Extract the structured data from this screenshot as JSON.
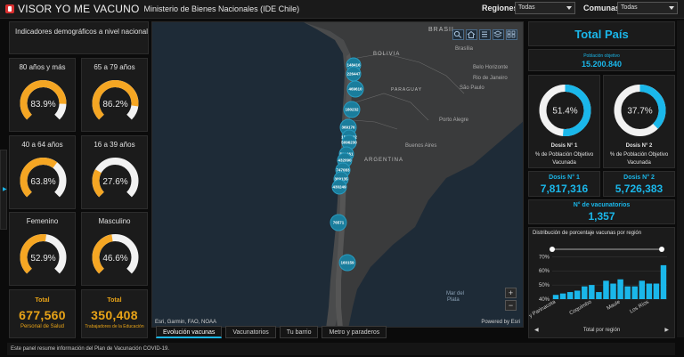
{
  "header": {
    "title": "VISOR YO ME VACUNO",
    "subtitle": "Ministerio de Bienes Nacionales (IDE Chile)",
    "regiones_label": "Regiones",
    "regiones_value": "Todas",
    "comunas_label": "Comunas",
    "comunas_value": "Todas"
  },
  "left": {
    "indicators_title": "Indicadores demográficos a nivel nacional",
    "gauges": [
      {
        "label": "80 años y más",
        "value_text": "83.9%",
        "value": 0.839,
        "color": "#f5a623"
      },
      {
        "label": "65 a 79 años",
        "value_text": "86.2%",
        "value": 0.862,
        "color": "#f5a623"
      },
      {
        "label": "40 a 64 años",
        "value_text": "63.8%",
        "value": 0.638,
        "color": "#f5a623"
      },
      {
        "label": "16 a 39 años",
        "value_text": "27.6%",
        "value": 0.276,
        "color": "#f5a623"
      },
      {
        "label": "Femenino",
        "value_text": "52.9%",
        "value": 0.529,
        "color": "#f5a623"
      },
      {
        "label": "Masculino",
        "value_text": "46.6%",
        "value": 0.466,
        "color": "#f5a623"
      }
    ],
    "totals": [
      {
        "title": "Total",
        "value": "677,560",
        "foot": "Personal de Salud"
      },
      {
        "title": "Total",
        "value": "350,408",
        "foot": "Trabajadores de la Educación"
      }
    ]
  },
  "map": {
    "country_labels": {
      "brasil": "BRASIL",
      "bolivia": "BOLIVIA",
      "paraguay": "PARAGUAY",
      "argentina": "ARGENTINA",
      "brasilia": "Brasília",
      "belo": "Belo Horizonte",
      "rio": "Rio de Janeiro",
      "sao": "São Paulo",
      "porto": "Porto Alegre",
      "buenos": "Buenos Aires",
      "mar": "Mar del",
      "plata": "Plata"
    },
    "clusters": [
      {
        "label": "148416"
      },
      {
        "label": "226447"
      },
      {
        "label": "469610"
      },
      {
        "label": "180232"
      },
      {
        "label": "369176"
      },
      {
        "label": "1545092"
      },
      {
        "label": "5096230"
      },
      {
        "label": "834461"
      },
      {
        "label": "432090"
      },
      {
        "label": "747083"
      },
      {
        "label": "309135"
      },
      {
        "label": "430249"
      },
      {
        "label": "76571"
      },
      {
        "label": "160159"
      }
    ],
    "attribution": "Esri, Garmin, FAO, NOAA",
    "powered": "Powered by Esri",
    "zoom_in": "+",
    "zoom_out": "−"
  },
  "tabs": [
    {
      "label": "Evolución vacunas",
      "active": true
    },
    {
      "label": "Vacunatorios",
      "active": false
    },
    {
      "label": "Tu barrio",
      "active": false
    },
    {
      "label": "Metro y paraderos",
      "active": false
    }
  ],
  "footer": "Este panel resume información del Plan de Vacunación COVID-19.",
  "right": {
    "total_pais": "Total País",
    "poblacion_label": "Población objetivo",
    "poblacion_value": "15.200.840",
    "donuts": [
      {
        "value_text": "51.4%",
        "value": 0.514,
        "title": "Dosis N° 1",
        "line1": "% de Población Objetivo",
        "line2": "Vacunada"
      },
      {
        "value_text": "37.7%",
        "value": 0.377,
        "title": "Dosis N° 2",
        "line1": "% de Población Objetivo",
        "line2": "Vacunada"
      }
    ],
    "dosis1_label": "Dosis N° 1",
    "dosis1_value": "7,817,316",
    "dosis2_label": "Dosis N° 2",
    "dosis2_value": "5,726,383",
    "vacunatorios_label": "N° de vacunatorios",
    "vacunatorios_value": "1,357",
    "chart_title": "Distribución de porcentaje vacunas por región",
    "chart_foot": "Total por región",
    "accent": "#1ab7ea"
  },
  "chart_data": {
    "type": "bar",
    "title": "Distribución de porcentaje vacunas por región",
    "xlabel": "Total por región",
    "ylabel": "",
    "yticks": [
      "40%",
      "50%",
      "60%",
      "70%"
    ],
    "ylim": [
      40,
      74
    ],
    "tick_categories": [
      "a y Parinacota",
      "Coquimbo",
      "Maule",
      "Los Ríos"
    ],
    "values": [
      43,
      44,
      45,
      46,
      49,
      50,
      45,
      53,
      51,
      54,
      49,
      49,
      53,
      51,
      51,
      64
    ]
  }
}
